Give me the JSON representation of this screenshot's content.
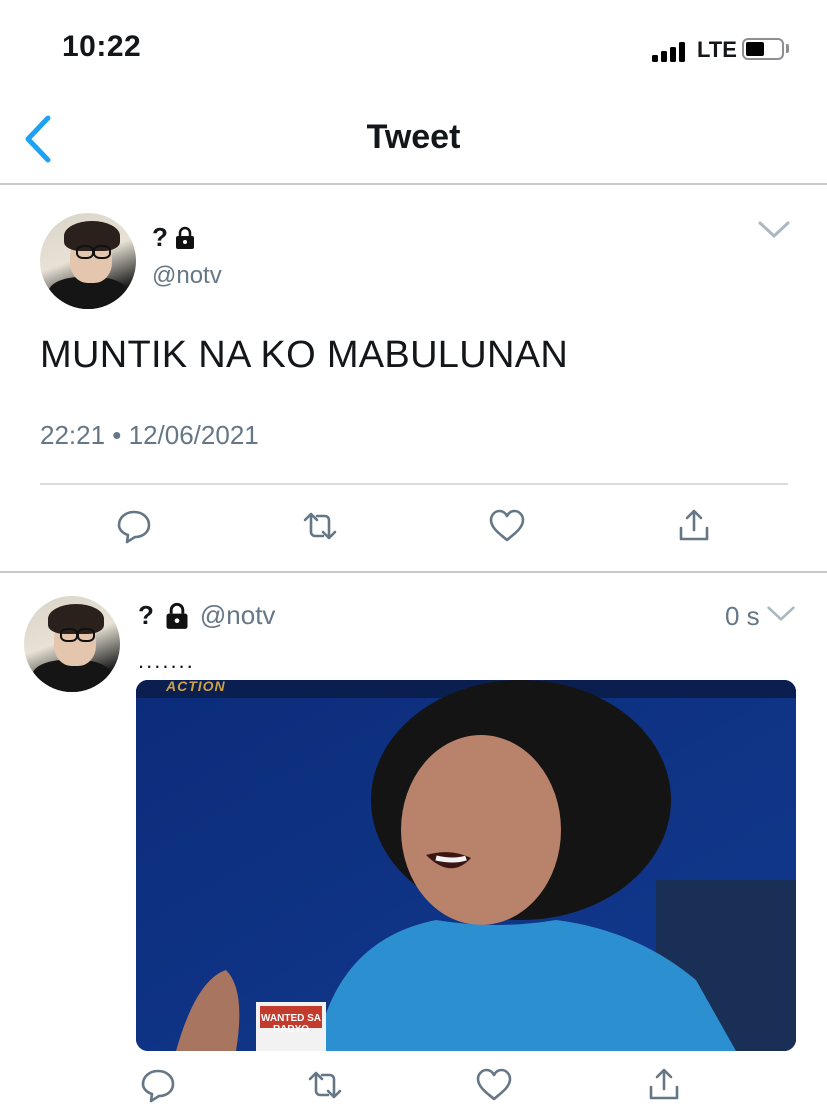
{
  "status_bar": {
    "time": "10:22",
    "network": "LTE"
  },
  "nav": {
    "title": "Tweet",
    "back_icon": "chevron-left-icon"
  },
  "main_tweet": {
    "display_name": "?",
    "handle": "@notv",
    "text": "MUNTIK NA KO MABULUNAN",
    "timestamp": "22:21 • 12/06/2021",
    "actions": [
      "reply-icon",
      "retweet-icon",
      "like-icon",
      "share-icon"
    ]
  },
  "reply_tweet": {
    "display_name": "?",
    "handle": "@notv",
    "time_ago": "0 s",
    "text": ".......",
    "media_overlay_top": "ACTION",
    "media_overlay_sign": "WANTED SA RADYO",
    "actions": [
      "reply-icon",
      "retweet-icon",
      "like-icon",
      "share-icon"
    ]
  },
  "colors": {
    "accent": "#1da1f2",
    "secondary_text": "#657786",
    "divider": "#c8c8cc"
  }
}
